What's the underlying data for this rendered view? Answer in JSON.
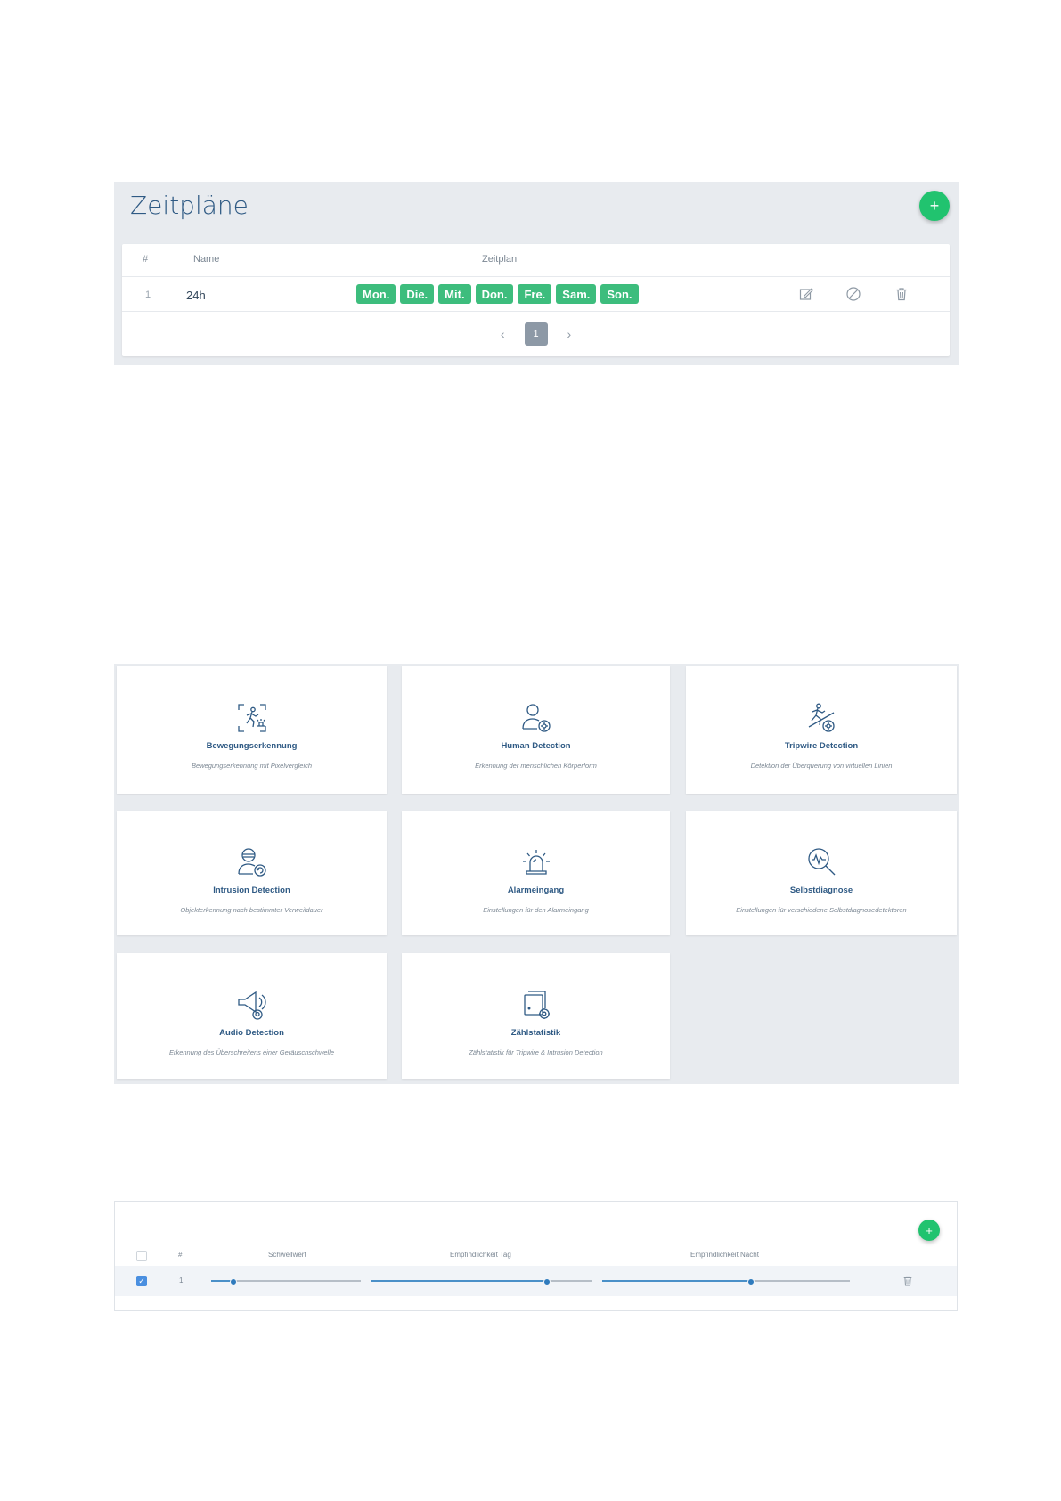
{
  "schedules": {
    "title": "Zeitpläne",
    "add_label": "+",
    "columns": {
      "num": "#",
      "name": "Name",
      "schedule": "Zeitplan"
    },
    "rows": [
      {
        "num": "1",
        "name": "24h",
        "days": [
          "Mon.",
          "Die.",
          "Mit.",
          "Don.",
          "Fre.",
          "Sam.",
          "Son."
        ]
      }
    ],
    "pagination": {
      "prev": "‹",
      "page": "1",
      "next": "›"
    },
    "actions": [
      "edit-icon",
      "disable-icon",
      "trash-icon"
    ]
  },
  "features": [
    {
      "icon": "motion-detection-icon",
      "title": "Bewegungserkennung",
      "desc": "Bewegungserkennung mit Pixelvergleich"
    },
    {
      "icon": "human-detection-icon",
      "title": "Human Detection",
      "desc": "Erkennung der menschlichen Körperform"
    },
    {
      "icon": "tripwire-detection-icon",
      "title": "Tripwire Detection",
      "desc": "Detektion der Überquerung von virtuellen Linien"
    },
    {
      "icon": "intrusion-detection-icon",
      "title": "Intrusion Detection",
      "desc": "Objekterkennung nach bestimmter Verweildauer"
    },
    {
      "icon": "alarm-light-icon",
      "title": "Alarmeingang",
      "desc": "Einstellungen für den Alarmeingang"
    },
    {
      "icon": "self-diagnosis-icon",
      "title": "Selbstdiagnose",
      "desc": "Einstellungen für verschiedene Selbstdiagnosedetektoren"
    },
    {
      "icon": "audio-detection-icon",
      "title": "Audio Detection",
      "desc": "Erkennung des Überschreitens einer Geräuschschwelle"
    },
    {
      "icon": "counting-stats-icon",
      "title": "Zählstatistik",
      "desc": "Zählstatistik für Tripwire & Intrusion Detection"
    }
  ],
  "detection": {
    "add_label": "+",
    "columns": {
      "num": "#",
      "threshold": "Schwellwert",
      "sens_day": "Empfindlichkeit Tag",
      "sens_night": "Empfindlichkeit Nacht"
    },
    "rows": [
      {
        "num": "1",
        "checked": true,
        "threshold": 0.15,
        "sens_day": 0.8,
        "sens_night": 0.6
      }
    ]
  },
  "colors": {
    "accent_green": "#21c36f",
    "day_green": "#3dbd7d",
    "slider_blue": "#4a90c8",
    "title_blue": "#2f5a84"
  }
}
